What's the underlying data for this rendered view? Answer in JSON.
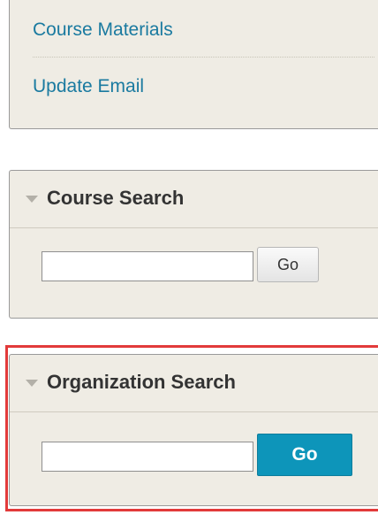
{
  "links": [
    {
      "label": "Course Materials"
    },
    {
      "label": "Update Email"
    }
  ],
  "course_search": {
    "title": "Course Search",
    "input_value": "",
    "go_label": "Go"
  },
  "org_search": {
    "title": "Organization Search",
    "input_value": "",
    "go_label": "Go"
  },
  "colors": {
    "link": "#1a7aa0",
    "panel_bg": "#efece4",
    "primary_button": "#0d95ba",
    "highlight": "#e23a3a"
  }
}
